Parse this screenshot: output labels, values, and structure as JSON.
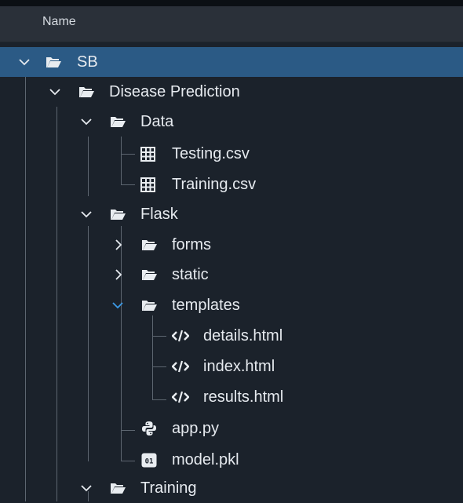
{
  "window": {
    "column_header": "Name"
  },
  "colors": {
    "selection": "#2b5a85",
    "chevron_active": "#3c9be8",
    "folder": "#e8ecf0"
  },
  "tree": [
    {
      "label": "SB",
      "type": "folder",
      "expanded": true,
      "selected": true
    },
    {
      "label": "Disease Prediction",
      "type": "folder",
      "expanded": true
    },
    {
      "label": "Data",
      "type": "folder",
      "expanded": true
    },
    {
      "label": "Testing.csv",
      "type": "file",
      "icon": "table-icon"
    },
    {
      "label": "Training.csv",
      "type": "file",
      "icon": "table-icon"
    },
    {
      "label": "Flask",
      "type": "folder",
      "expanded": true
    },
    {
      "label": "forms",
      "type": "folder",
      "expanded": false
    },
    {
      "label": "static",
      "type": "folder",
      "expanded": false
    },
    {
      "label": "templates",
      "type": "folder",
      "expanded": true,
      "hovered": true
    },
    {
      "label": "details.html",
      "type": "file",
      "icon": "html-code-icon"
    },
    {
      "label": "index.html",
      "type": "file",
      "icon": "html-code-icon"
    },
    {
      "label": "results.html",
      "type": "file",
      "icon": "html-code-icon"
    },
    {
      "label": "app.py",
      "type": "file",
      "icon": "python-icon"
    },
    {
      "label": "model.pkl",
      "type": "file",
      "icon": "binary-file-icon"
    },
    {
      "label": "Training",
      "type": "folder",
      "expanded": true
    }
  ]
}
